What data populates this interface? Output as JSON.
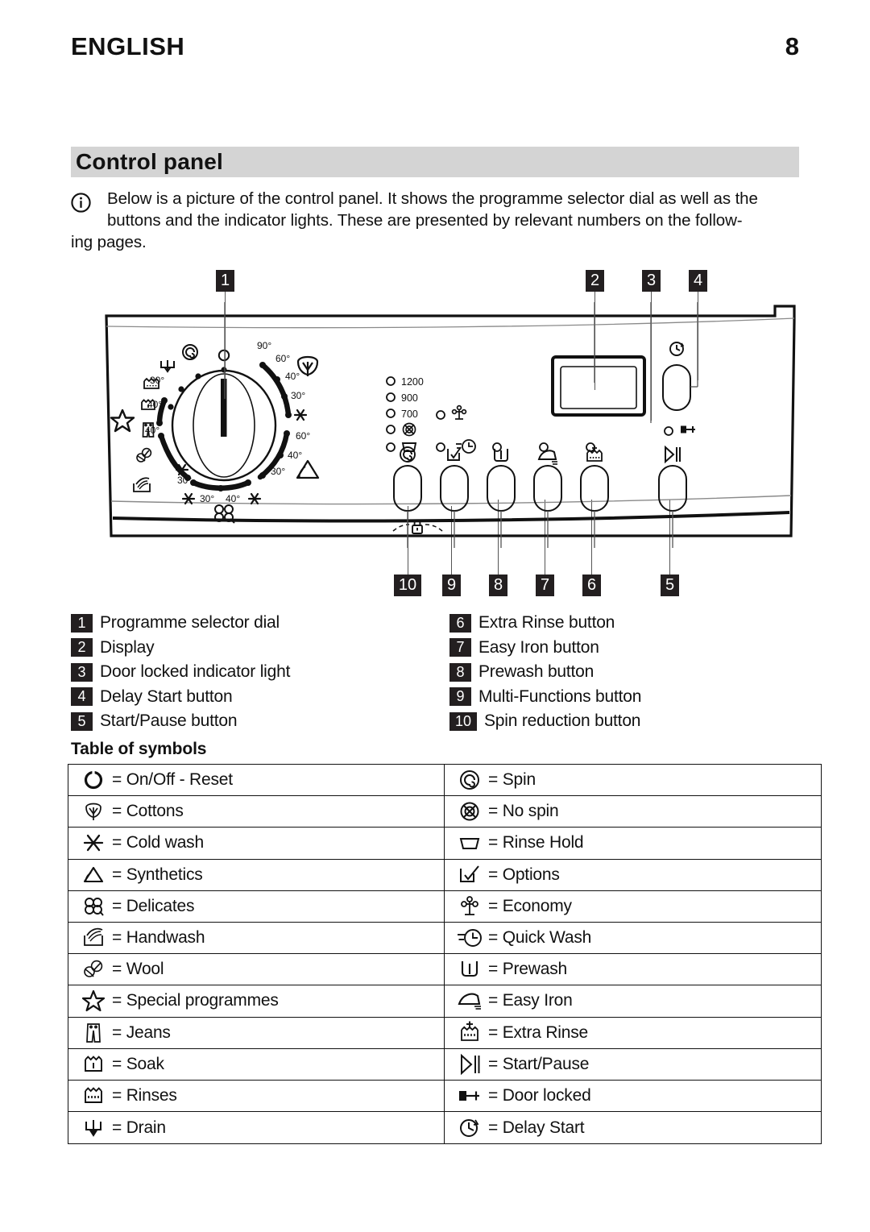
{
  "header": {
    "title": "ENGLISH",
    "page_number": "8"
  },
  "section": {
    "title": "Control panel"
  },
  "intro": {
    "line1": "Below is a picture of the control panel. It shows the programme selector dial as well as the",
    "line2": "buttons and the indicator lights. These are presented by relevant numbers on the follow-",
    "line3": "ing pages."
  },
  "diagram": {
    "callouts_top": [
      "1",
      "2",
      "3",
      "4"
    ],
    "callouts_bottom": [
      "10",
      "9",
      "8",
      "7",
      "6",
      "5"
    ],
    "dial": {
      "cottons_temps": [
        "90°",
        "60°",
        "40°",
        "30°"
      ],
      "synthetics_temps": [
        "60°",
        "40°",
        "30°"
      ],
      "delicates_temps": [
        "30°",
        "40°"
      ],
      "handwash_temp": "30°",
      "wool_temp": "40°",
      "jeans_temp": "40°",
      "soak_temp": "30°"
    },
    "spin_speeds": [
      "1200",
      "900",
      "700"
    ]
  },
  "legend": {
    "left": [
      {
        "num": "1",
        "label": "Programme selector dial"
      },
      {
        "num": "2",
        "label": "Display"
      },
      {
        "num": "3",
        "label": "Door locked indicator light"
      },
      {
        "num": "4",
        "label": "Delay Start button"
      },
      {
        "num": "5",
        "label": "Start/Pause button"
      }
    ],
    "right": [
      {
        "num": "6",
        "label": "Extra Rinse button"
      },
      {
        "num": "7",
        "label": "Easy Iron button"
      },
      {
        "num": "8",
        "label": "Prewash button"
      },
      {
        "num": "9",
        "label": "Multi-Functions button"
      },
      {
        "num": "10",
        "label": "Spin reduction button"
      }
    ]
  },
  "table": {
    "title": "Table of symbols",
    "left": [
      {
        "icon": "power-icon",
        "label": "= On/Off - Reset"
      },
      {
        "icon": "cottons-icon",
        "label": "= Cottons"
      },
      {
        "icon": "cold-wash-icon",
        "label": "= Cold wash"
      },
      {
        "icon": "synthetics-icon",
        "label": "= Synthetics"
      },
      {
        "icon": "delicates-icon",
        "label": "= Delicates"
      },
      {
        "icon": "handwash-icon",
        "label": "= Handwash"
      },
      {
        "icon": "wool-icon",
        "label": "= Wool"
      },
      {
        "icon": "special-programmes-icon",
        "label": "= Special programmes"
      },
      {
        "icon": "jeans-icon",
        "label": "= Jeans"
      },
      {
        "icon": "soak-icon",
        "label": "= Soak"
      },
      {
        "icon": "rinses-icon",
        "label": "= Rinses"
      },
      {
        "icon": "drain-icon",
        "label": "= Drain"
      }
    ],
    "right": [
      {
        "icon": "spin-icon",
        "label": "= Spin"
      },
      {
        "icon": "no-spin-icon",
        "label": "= No spin"
      },
      {
        "icon": "rinse-hold-icon",
        "label": "= Rinse Hold"
      },
      {
        "icon": "options-icon",
        "label": "= Options"
      },
      {
        "icon": "economy-icon",
        "label": "= Economy"
      },
      {
        "icon": "quick-wash-icon",
        "label": "= Quick Wash"
      },
      {
        "icon": "prewash-icon",
        "label": "= Prewash"
      },
      {
        "icon": "easy-iron-icon",
        "label": "= Easy Iron"
      },
      {
        "icon": "extra-rinse-icon",
        "label": "= Extra Rinse"
      },
      {
        "icon": "start-pause-icon",
        "label": "= Start/Pause"
      },
      {
        "icon": "door-locked-icon",
        "label": "= Door locked"
      },
      {
        "icon": "delay-start-icon",
        "label": "= Delay Start"
      }
    ]
  },
  "colors": {
    "badge": "#231f20",
    "section_bar": "#d4d4d4",
    "ink": "#111111"
  }
}
